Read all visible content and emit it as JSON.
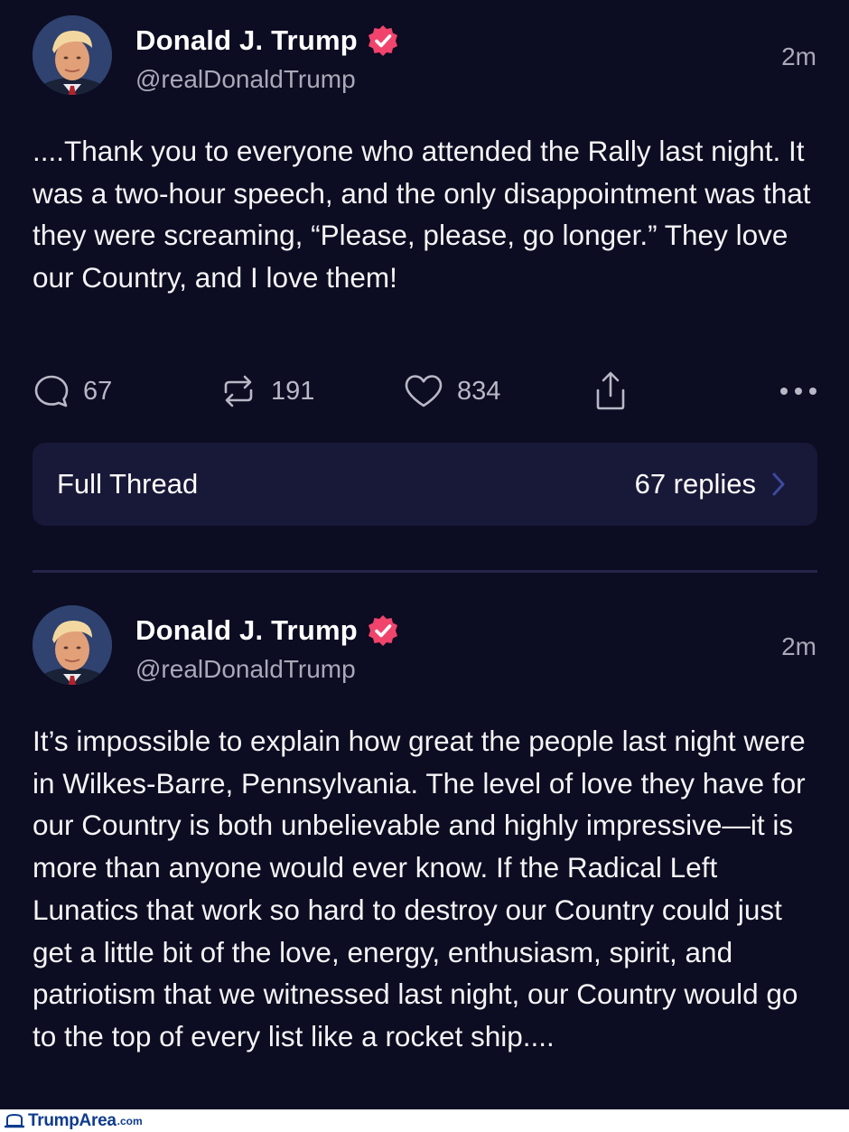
{
  "posts": [
    {
      "author": "Donald J. Trump",
      "handle": "@realDonaldTrump",
      "time": "2m",
      "text": "....Thank you to everyone who attended the Rally last night. It was a two-hour speech, and the only disappointment was that they were screaming, “Please, please, go longer.” They love our Country, and I love them!",
      "replies": "67",
      "reposts": "191",
      "likes": "834",
      "thread": {
        "label": "Full Thread",
        "replies_label": "67 replies"
      }
    },
    {
      "author": "Donald J. Trump",
      "handle": "@realDonaldTrump",
      "time": "2m",
      "text": "It’s impossible to explain how great the people last night were in Wilkes-Barre, Pennsylvania. The level of love they have for our Country is both unbelievable and highly impressive—it is more than anyone would ever know. If the Radical Left Lunatics that work so hard to destroy our Country could just get a little bit of the love, energy, enthusiasm, spirit, and patriotism that we witnessed last night, our Country would go to the top of every list like a rocket ship...."
    }
  ],
  "icons": {
    "verified": "verified-badge-icon",
    "reply": "comment-bubble-icon",
    "repost": "repost-arrows-icon",
    "like": "heart-icon",
    "share": "share-upload-icon",
    "more": "more-dots-icon",
    "chevron": "chevron-right-icon"
  },
  "colors": {
    "background": "#0c0c22",
    "card": "#181838",
    "verified": "#f0446c",
    "muted": "#a9a9b8",
    "chevron": "#3c4a9e"
  },
  "footer": {
    "brand": "TrumpArea",
    "suffix": ".com"
  }
}
